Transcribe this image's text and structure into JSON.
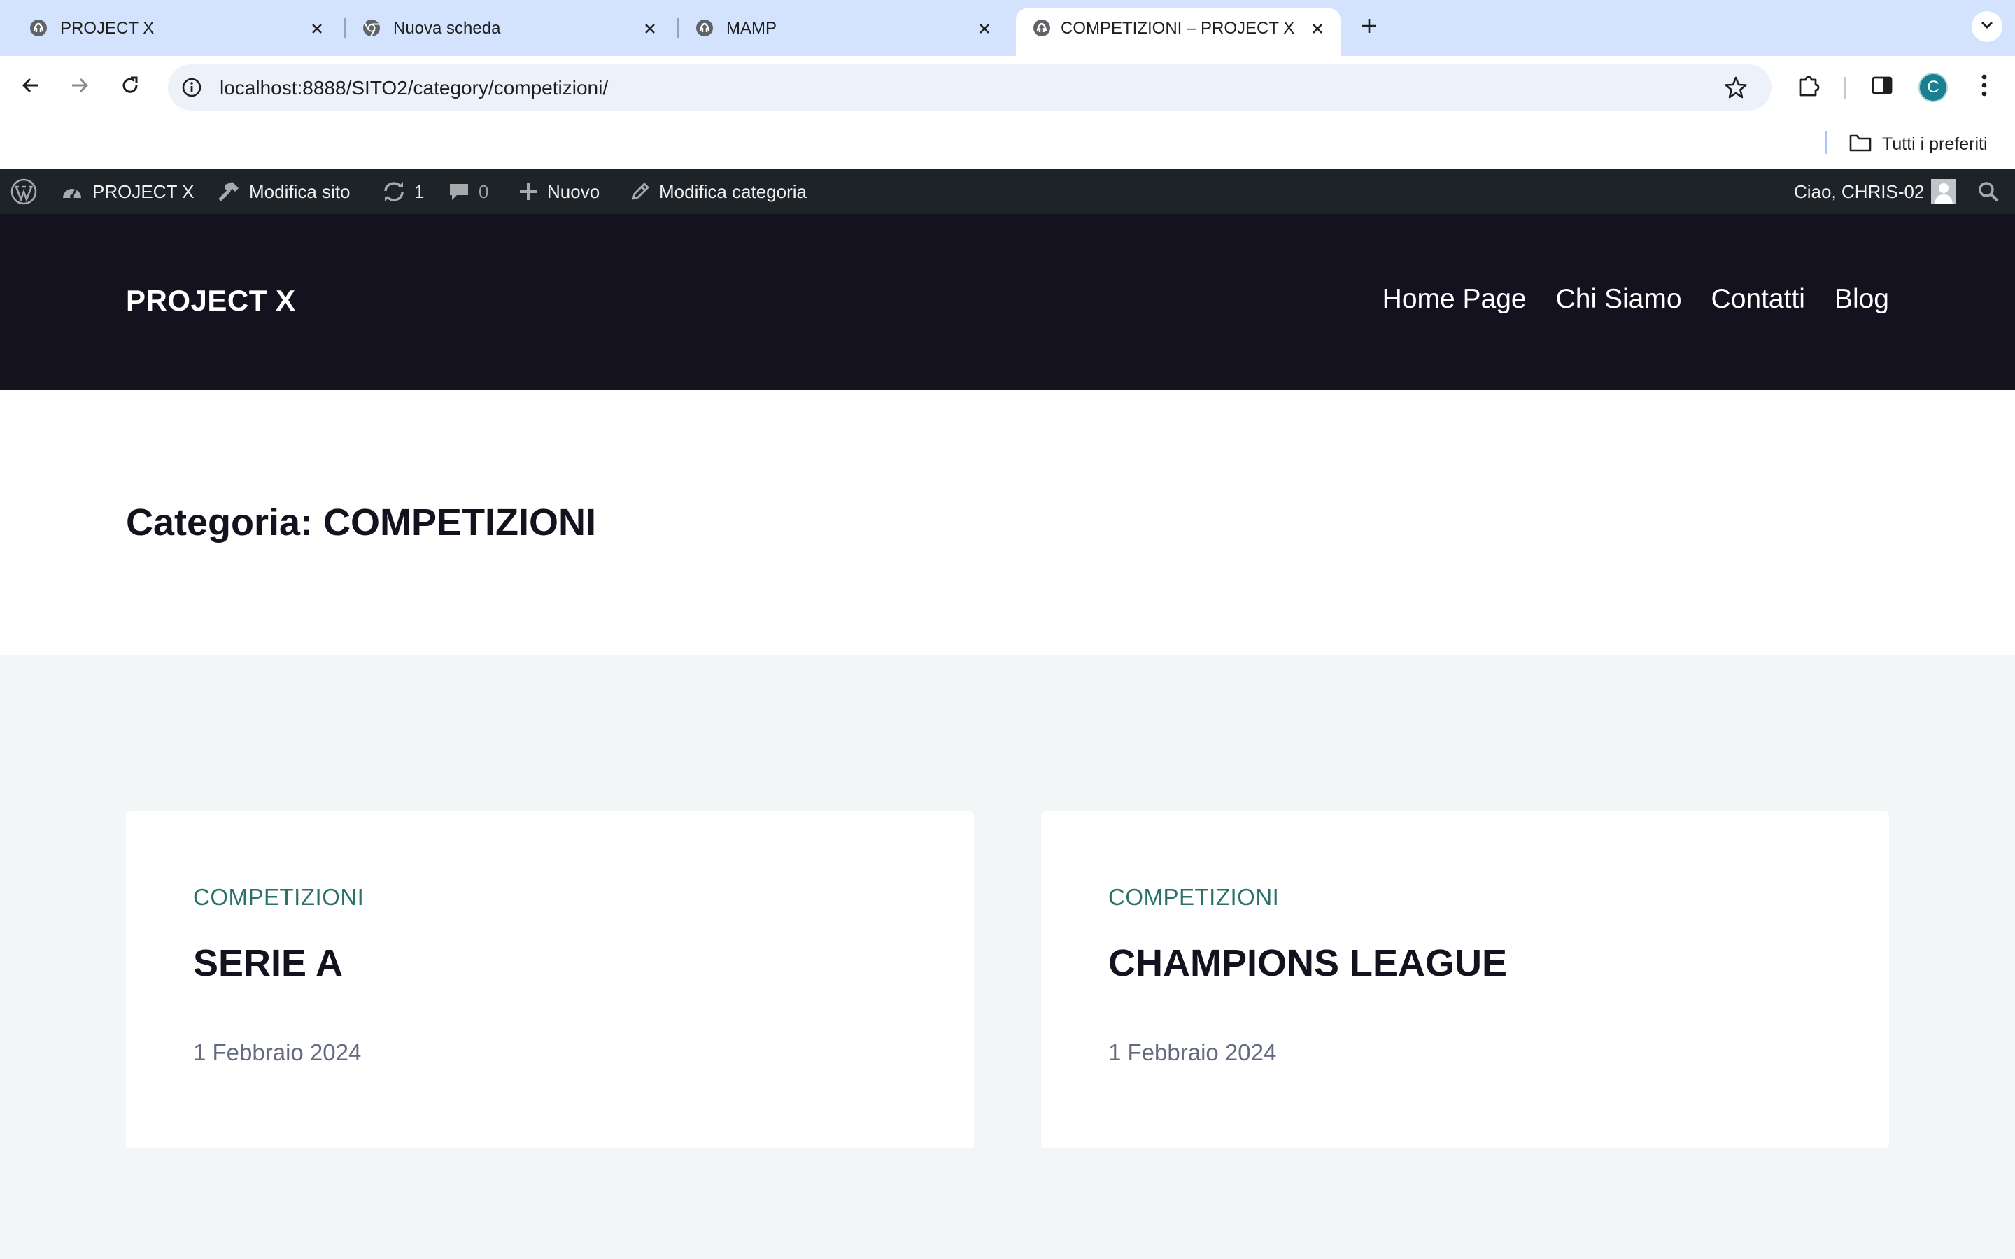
{
  "browser": {
    "tabs": [
      {
        "title": "PROJECT X",
        "icon": "site-favicon-icon",
        "active": false
      },
      {
        "title": "Nuova scheda",
        "icon": "chrome-icon",
        "active": false
      },
      {
        "title": "MAMP",
        "icon": "site-favicon-icon",
        "active": false
      },
      {
        "title": "COMPETIZIONI – PROJECT X",
        "icon": "site-favicon-icon",
        "active": true
      }
    ],
    "url": "localhost:8888/SITO2/category/competizioni/",
    "profile_initial": "C",
    "bookmarks": {
      "folder_label": "Tutti i preferiti"
    }
  },
  "admin_bar": {
    "site_name": "PROJECT X",
    "edit_site": "Modifica sito",
    "updates_count": "1",
    "comments_count": "0",
    "new_label": "Nuovo",
    "edit_category": "Modifica categoria",
    "greeting": "Ciao, CHRIS-02"
  },
  "site": {
    "title": "PROJECT X",
    "nav": [
      "Home Page",
      "Chi Siamo",
      "Contatti",
      "Blog"
    ]
  },
  "archive": {
    "title": "Categoria: COMPETIZIONI"
  },
  "posts": [
    {
      "category": "COMPETIZIONI",
      "title": "SERIE A",
      "date": "1 Febbraio 2024"
    },
    {
      "category": "COMPETIZIONI",
      "title": "CHAMPIONS LEAGUE",
      "date": "1 Febbraio 2024"
    }
  ],
  "colors": {
    "tabstrip": "#d3e3fd",
    "admin_bar": "#1d2327",
    "site_header": "#14121f",
    "posts_bg": "#f3f6f6",
    "category_accent": "#2b7168",
    "profile_avatar": "#1a7f8e"
  }
}
